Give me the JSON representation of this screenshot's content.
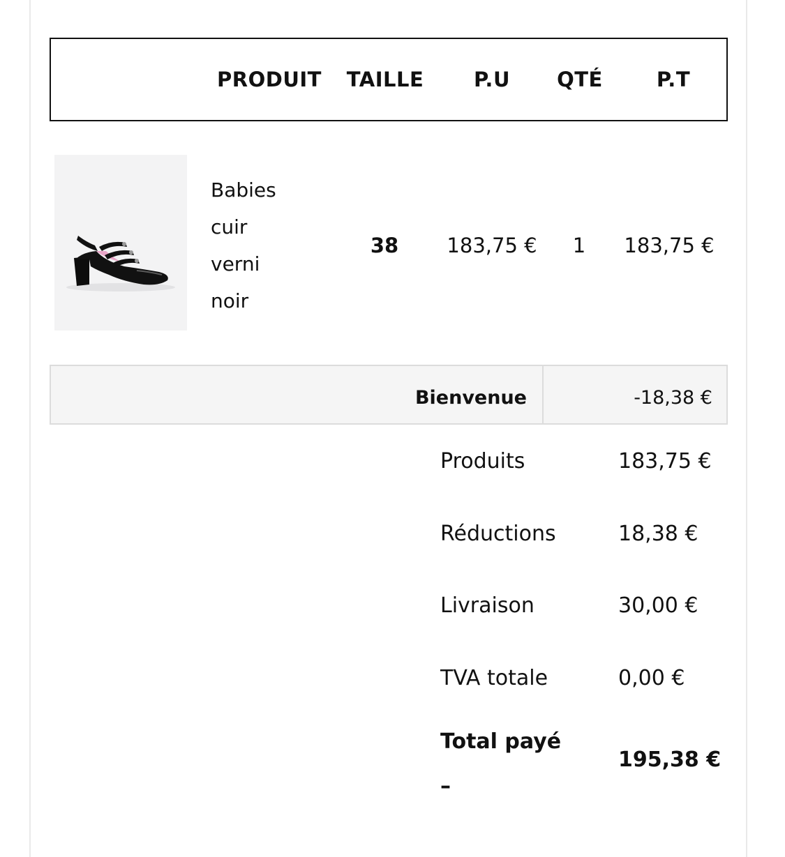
{
  "header": {
    "columns": [
      "PRODUIT",
      "TAILLE",
      "P.U",
      "QTÉ",
      "P.T"
    ]
  },
  "item": {
    "image_alt": "Babies cuir verni noir",
    "name_lines": [
      "Babies",
      "cuir",
      "verni",
      "noir"
    ],
    "size": "38",
    "unit_price": "183,75 €",
    "quantity": "1",
    "total_price": "183,75 €"
  },
  "discount": {
    "label": "Bienvenue",
    "value": "-18,38 €"
  },
  "totals": {
    "products_label": "Produits",
    "products_value": "183,75 €",
    "reductions_label": "Réductions",
    "reductions_value": "18,38 €",
    "shipping_label": "Livraison",
    "shipping_value": "30,00 €",
    "vat_label": "TVA totale",
    "vat_value": "0,00 €",
    "total_label": "Total payé",
    "total_dash": "–",
    "total_value": "195,38 €"
  },
  "colors": {
    "text": "#111111",
    "border": "#111111",
    "discount_bg": "#f5f5f5",
    "discount_border": "#dcdcdc",
    "shoe_lining": "#e8a6c8"
  }
}
